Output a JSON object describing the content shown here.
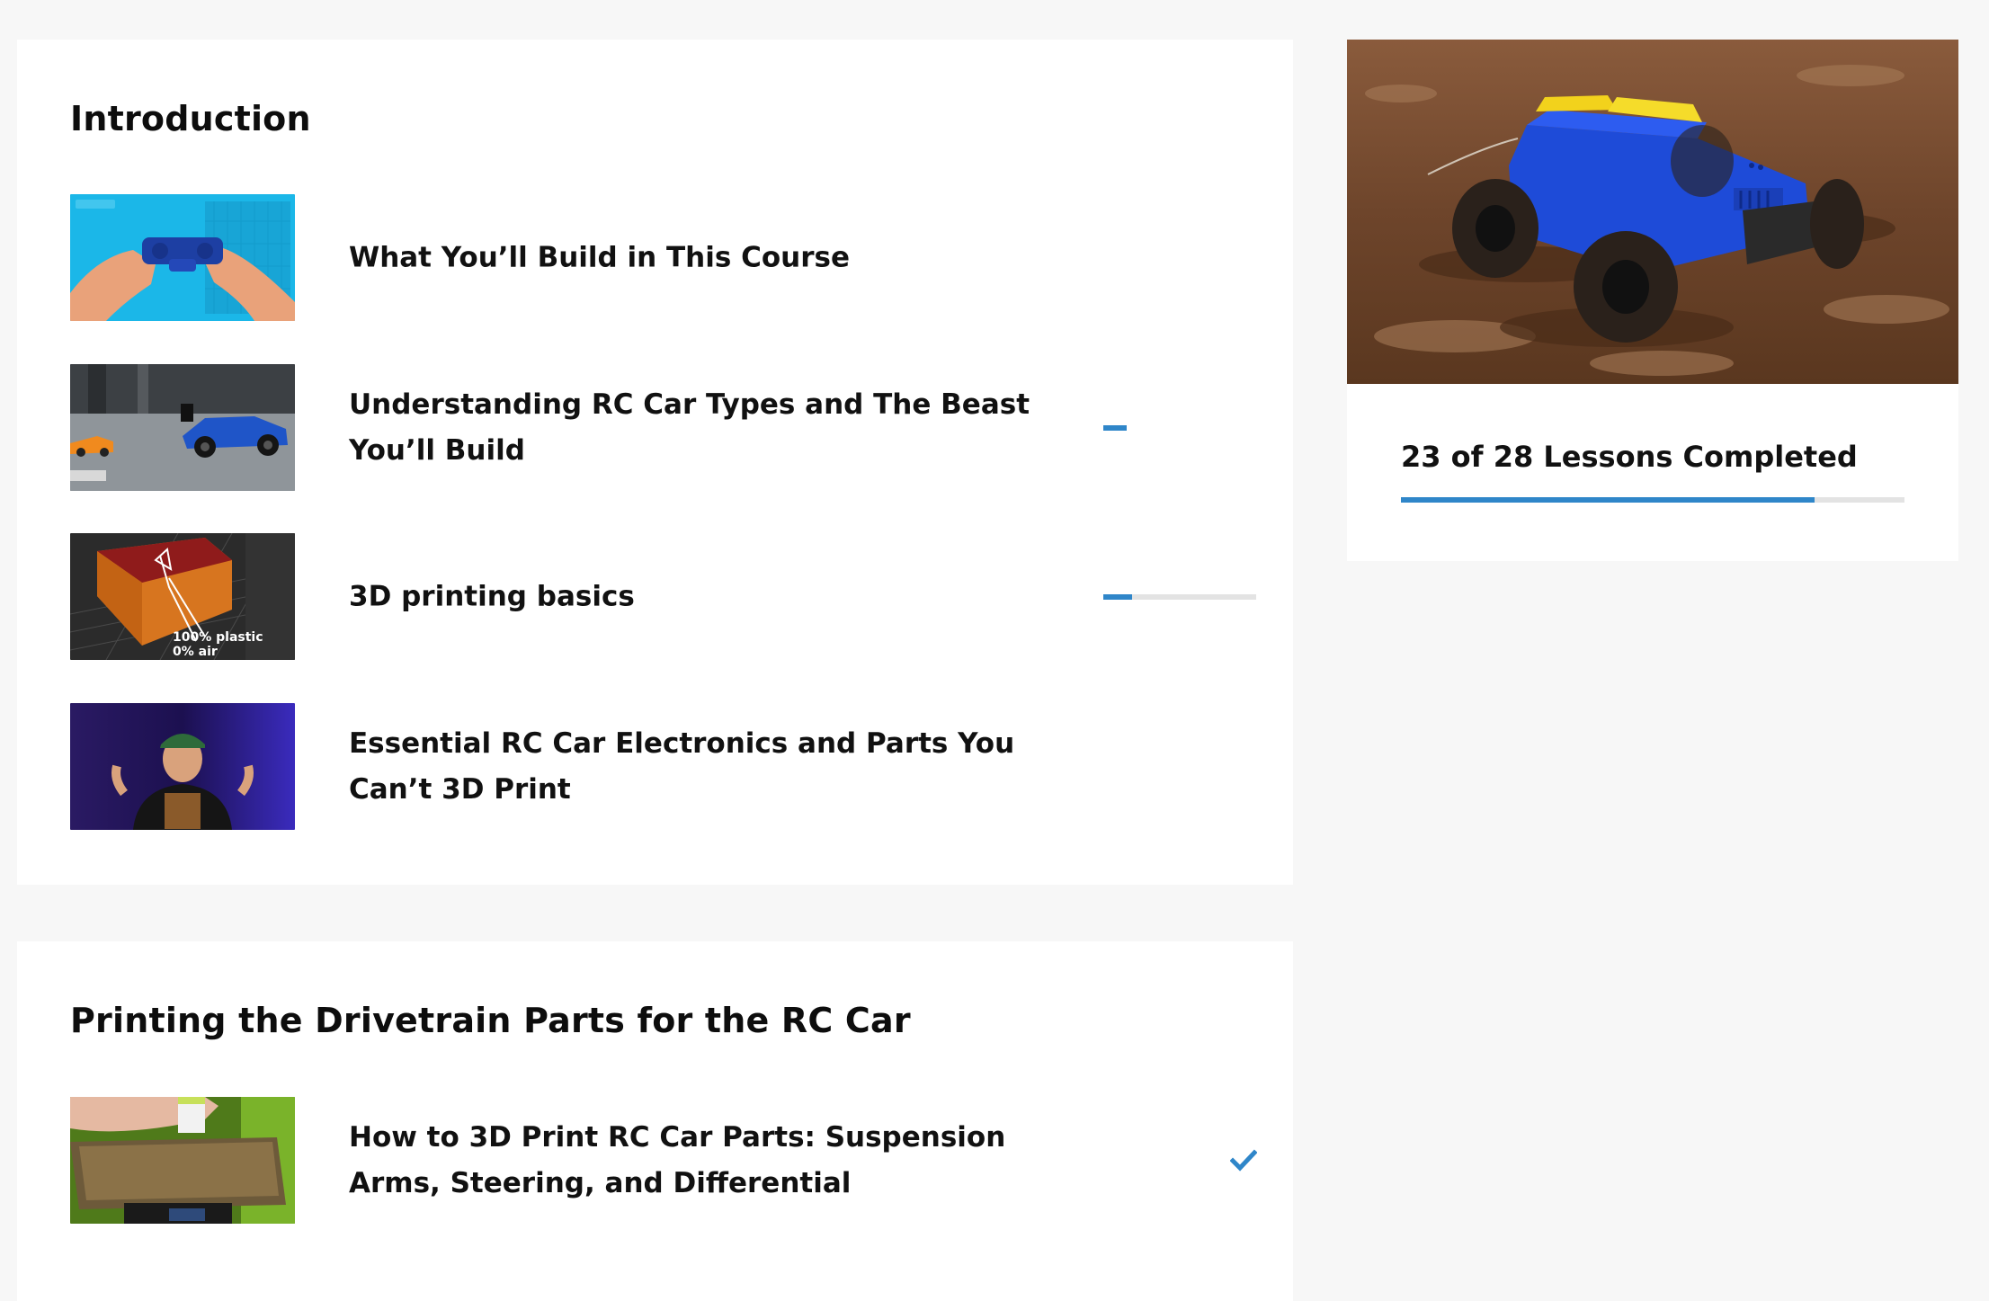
{
  "sections": [
    {
      "title": "Introduction",
      "lessons": [
        {
          "title": "What You’ll Build in This Course",
          "progress": null,
          "completed": false,
          "thumbnail": "hands-holding-blue-part-thumbnail"
        },
        {
          "title": "Understanding RC Car Types and The Beast You’ll Build",
          "progress": 0.15,
          "completed": false,
          "thumbnail": "toy-cars-on-floor-thumbnail"
        },
        {
          "title": "3D printing basics",
          "progress": 0.19,
          "completed": false,
          "thumbnail": "infill-cube-thumbnail",
          "thumbnail_text": [
            "100% plastic",
            "0% air"
          ]
        },
        {
          "title": "Essential RC Car Electronics and Parts You Can’t 3D Print",
          "progress": null,
          "completed": false,
          "thumbnail": "presenter-thumbnail"
        }
      ]
    },
    {
      "title": "Printing the Drivetrain Parts for the RC Car",
      "lessons": [
        {
          "title": "How to 3D Print RC Car Parts: Suspension Arms, Steering, and Differential",
          "progress": null,
          "completed": true,
          "thumbnail": "print-bed-thumbnail"
        }
      ]
    }
  ],
  "course": {
    "cover": "rc-car-in-mud-image",
    "progress_label": "23 of 28 Lessons Completed",
    "lessons_completed": 23,
    "lessons_total": 28
  },
  "colors": {
    "accent": "#2f86c9",
    "track": "#e3e3e3",
    "background": "#f7f7f7",
    "card": "#ffffff"
  },
  "icons": {
    "completed": "checkmark-icon"
  }
}
